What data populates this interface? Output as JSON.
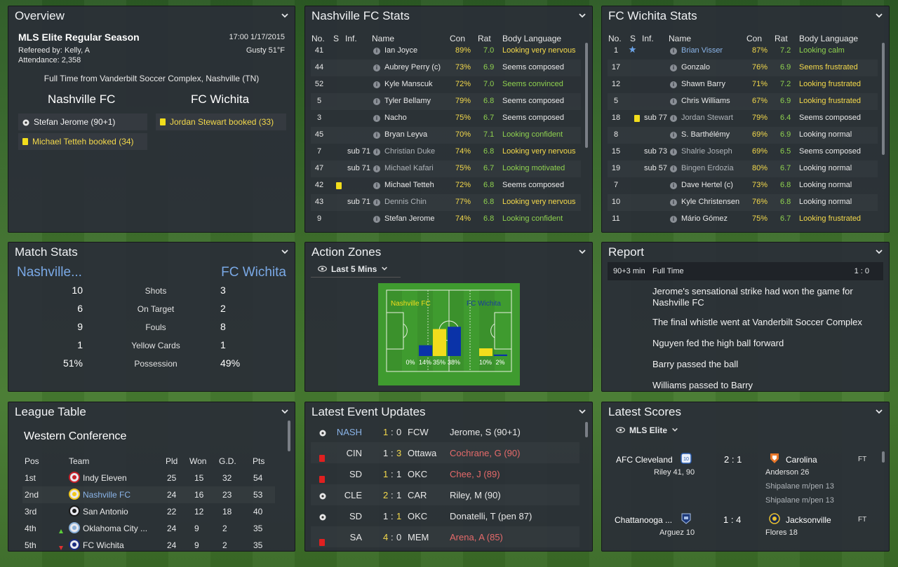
{
  "overview": {
    "title": "Overview",
    "competition": "MLS Elite Regular Season",
    "datetime": "17:00 1/17/2015",
    "referee": "Refereed by: Kelly, A",
    "weather": "Gusty 51°F",
    "attendance": "Attendance: 2,358",
    "result_text": "Full Time from Vanderbilt Soccer Complex, Nashville (TN)",
    "home_team": "Nashville FC",
    "away_team": "FC Wichita",
    "home_events": [
      "Stefan Jerome (90+1)",
      "Michael Tetteh booked (34)"
    ],
    "away_events": [
      "Jordan Stewart booked (33)"
    ]
  },
  "home_stats": {
    "title": "Nashville FC Stats",
    "headers": [
      "No.",
      "S",
      "Inf.",
      "Name",
      "Con",
      "Rat",
      "Body Language"
    ],
    "rows": [
      {
        "no": "41",
        "inf": "",
        "name": "Ian Joyce",
        "con": "89%",
        "rat": "7.0",
        "body": "Looking very nervous",
        "body_color": "yellow"
      },
      {
        "no": "44",
        "inf": "",
        "name": "Aubrey Perry (c)",
        "con": "73%",
        "rat": "6.9",
        "body": "Seems composed",
        "body_color": "white"
      },
      {
        "no": "52",
        "inf": "",
        "name": "Kyle Manscuk",
        "con": "72%",
        "rat": "7.0",
        "body": "Seems convinced",
        "body_color": "green"
      },
      {
        "no": "5",
        "inf": "",
        "name": "Tyler Bellamy",
        "con": "79%",
        "rat": "6.8",
        "body": "Seems composed",
        "body_color": "white"
      },
      {
        "no": "3",
        "inf": "",
        "name": "Nacho",
        "con": "75%",
        "rat": "6.7",
        "body": "Seems composed",
        "body_color": "white"
      },
      {
        "no": "45",
        "inf": "",
        "name": "Bryan Leyva",
        "con": "70%",
        "rat": "7.1",
        "body": "Looking confident",
        "body_color": "green"
      },
      {
        "no": "7",
        "inf": "sub 71",
        "name": "Christian Duke",
        "con": "74%",
        "rat": "6.8",
        "body": "Looking very nervous",
        "body_color": "yellow"
      },
      {
        "no": "47",
        "inf": "sub 71",
        "name": "Michael Kafari",
        "con": "75%",
        "rat": "6.7",
        "body": "Looking motivated",
        "body_color": "green"
      },
      {
        "no": "42",
        "inf": "",
        "name": "Michael Tetteh",
        "con": "72%",
        "rat": "6.8",
        "body": "Seems composed",
        "body_color": "white"
      },
      {
        "no": "43",
        "inf": "sub 71",
        "name": "Dennis Chin",
        "con": "77%",
        "rat": "6.8",
        "body": "Looking very nervous",
        "body_color": "yellow"
      },
      {
        "no": "9",
        "inf": "",
        "name": "Stefan Jerome",
        "con": "74%",
        "rat": "6.8",
        "body": "Looking confident",
        "body_color": "green"
      }
    ]
  },
  "away_stats": {
    "title": "FC Wichita Stats",
    "headers": [
      "No.",
      "S",
      "Inf.",
      "Name",
      "Con",
      "Rat",
      "Body Language"
    ],
    "rows": [
      {
        "no": "1",
        "inf": "",
        "name": "Brian Visser",
        "con": "87%",
        "rat": "7.2",
        "body": "Looking calm",
        "body_color": "green"
      },
      {
        "no": "17",
        "inf": "",
        "name": "Gonzalo",
        "con": "76%",
        "rat": "6.9",
        "body": "Seems frustrated",
        "body_color": "yellow"
      },
      {
        "no": "12",
        "inf": "",
        "name": "Shawn Barry",
        "con": "71%",
        "rat": "7.2",
        "body": "Looking frustrated",
        "body_color": "yellow"
      },
      {
        "no": "5",
        "inf": "",
        "name": "Chris Williams",
        "con": "67%",
        "rat": "6.9",
        "body": "Looking frustrated",
        "body_color": "yellow"
      },
      {
        "no": "18",
        "inf": "sub 77",
        "name": "Jordan Stewart",
        "con": "79%",
        "rat": "6.4",
        "body": "Seems composed",
        "body_color": "white"
      },
      {
        "no": "8",
        "inf": "",
        "name": "S. Barthélémy",
        "con": "69%",
        "rat": "6.9",
        "body": "Looking normal",
        "body_color": "white"
      },
      {
        "no": "15",
        "inf": "sub 73",
        "name": "Shalrie Joseph",
        "con": "69%",
        "rat": "6.5",
        "body": "Seems composed",
        "body_color": "white"
      },
      {
        "no": "19",
        "inf": "sub 57",
        "name": "Bingen Erdozia",
        "con": "80%",
        "rat": "6.7",
        "body": "Looking normal",
        "body_color": "white"
      },
      {
        "no": "7",
        "inf": "",
        "name": "Dave Hertel (c)",
        "con": "73%",
        "rat": "6.8",
        "body": "Looking normal",
        "body_color": "white"
      },
      {
        "no": "10",
        "inf": "",
        "name": "Kyle Christensen",
        "con": "76%",
        "rat": "6.8",
        "body": "Looking normal",
        "body_color": "white"
      },
      {
        "no": "11",
        "inf": "",
        "name": "Mário Gómez",
        "con": "75%",
        "rat": "6.7",
        "body": "Looking frustrated",
        "body_color": "yellow"
      }
    ]
  },
  "match_stats": {
    "title": "Match Stats",
    "home": "Nashville...",
    "away": "FC Wichita",
    "rows": [
      {
        "label": "Shots",
        "home": "10",
        "away": "3"
      },
      {
        "label": "On Target",
        "home": "6",
        "away": "2"
      },
      {
        "label": "Fouls",
        "home": "9",
        "away": "8"
      },
      {
        "label": "Yellow Cards",
        "home": "1",
        "away": "1"
      },
      {
        "label": "Possession",
        "home": "51%",
        "away": "49%"
      }
    ]
  },
  "action_zones": {
    "title": "Action Zones",
    "filter": "Last 5 Mins",
    "home_label": "Nashville FC",
    "away_label": "FC Wichita",
    "zones": [
      {
        "label_home": "0%",
        "label_away": "14%",
        "home": 0,
        "away": 14
      },
      {
        "label_home": "35%",
        "label_away": "38%",
        "home": 35,
        "away": 38
      },
      {
        "label_home": "10%",
        "label_away": "2%",
        "home": 10,
        "away": 2
      }
    ],
    "home_color": "#f2dd1c",
    "away_color": "#0a33a8"
  },
  "report": {
    "title": "Report",
    "minute": "90+3 min",
    "status": "Full Time",
    "score": "1 : 0",
    "items": [
      "Jerome's sensational strike had won the game for Nashville FC",
      "The final whistle went at Vanderbilt Soccer Complex",
      "Nguyen fed the high ball forward",
      "Barry passed the ball",
      "Williams passed to Barry"
    ]
  },
  "league_table": {
    "title": "League Table",
    "conference": "Western Conference",
    "headers": [
      "Pos",
      "Team",
      "Pld",
      "Won",
      "G.D.",
      "Pts"
    ],
    "rows": [
      {
        "pos": "1st",
        "team": "Indy Eleven",
        "pld": "25",
        "won": "15",
        "gd": "32",
        "pts": "54",
        "highlight": false,
        "move": ""
      },
      {
        "pos": "2nd",
        "team": "Nashville FC",
        "pld": "24",
        "won": "16",
        "gd": "23",
        "pts": "53",
        "highlight": true,
        "move": ""
      },
      {
        "pos": "3rd",
        "team": "San Antonio",
        "pld": "22",
        "won": "12",
        "gd": "18",
        "pts": "40",
        "highlight": false,
        "move": ""
      },
      {
        "pos": "4th",
        "team": "Oklahoma City ...",
        "pld": "24",
        "won": "9",
        "gd": "2",
        "pts": "35",
        "highlight": false,
        "move": "up"
      },
      {
        "pos": "5th",
        "team": "FC Wichita",
        "pld": "24",
        "won": "9",
        "gd": "2",
        "pts": "35",
        "highlight": false,
        "move": "down"
      }
    ]
  },
  "events": {
    "title": "Latest Event Updates",
    "rows": [
      {
        "type": "goal",
        "home": "NASH",
        "hs": "1",
        "as": "0",
        "away": "FCW",
        "detail": "Jerome, S (90+1)",
        "detail_color": "white",
        "home_color": "blue",
        "hs_color": "yellow",
        "as_color": "white"
      },
      {
        "type": "red",
        "home": "CIN",
        "hs": "1",
        "as": "3",
        "away": "Ottawa",
        "detail": "Cochrane, G (90)",
        "detail_color": "red",
        "home_color": "white",
        "hs_color": "white",
        "as_color": "yellow"
      },
      {
        "type": "red",
        "home": "SD",
        "hs": "1",
        "as": "1",
        "away": "OKC",
        "detail": "Chee, J (89)",
        "detail_color": "red",
        "home_color": "white",
        "hs_color": "yellow",
        "as_color": "white"
      },
      {
        "type": "goal",
        "home": "CLE",
        "hs": "2",
        "as": "1",
        "away": "CAR",
        "detail": "Riley, M (90)",
        "detail_color": "white",
        "home_color": "white",
        "hs_color": "yellow",
        "as_color": "white"
      },
      {
        "type": "goal",
        "home": "SD",
        "hs": "1",
        "as": "1",
        "away": "OKC",
        "detail": "Donatelli, T (pen 87)",
        "detail_color": "white",
        "home_color": "white",
        "hs_color": "white",
        "as_color": "yellow"
      },
      {
        "type": "red",
        "home": "SA",
        "hs": "4",
        "as": "0",
        "away": "MEM",
        "detail": "Arena, A (85)",
        "detail_color": "red",
        "home_color": "white",
        "hs_color": "yellow",
        "as_color": "white"
      }
    ]
  },
  "latest_scores": {
    "title": "Latest Scores",
    "filter": "MLS Elite",
    "matches": [
      {
        "home": "AFC Cleveland",
        "score": "2 : 1",
        "away": "Carolina",
        "status": "FT",
        "home_scorers": [
          "Riley 41, 90"
        ],
        "away_scorers": [
          "Anderson 26",
          "Shipalane m/pen 13",
          "Shipalane m/pen 13"
        ]
      },
      {
        "home": "Chattanooga ...",
        "score": "1 : 4",
        "away": "Jacksonville",
        "status": "FT",
        "home_scorers": [
          "Arguez 10"
        ],
        "away_scorers": [
          "Flores 18"
        ]
      }
    ]
  },
  "colors": {
    "accent_blue": "#7aa9e6",
    "yellow": "#f4d94b",
    "green": "#8fd14f",
    "red": "#e56a6a",
    "panel_bg": "#2b2f37"
  }
}
